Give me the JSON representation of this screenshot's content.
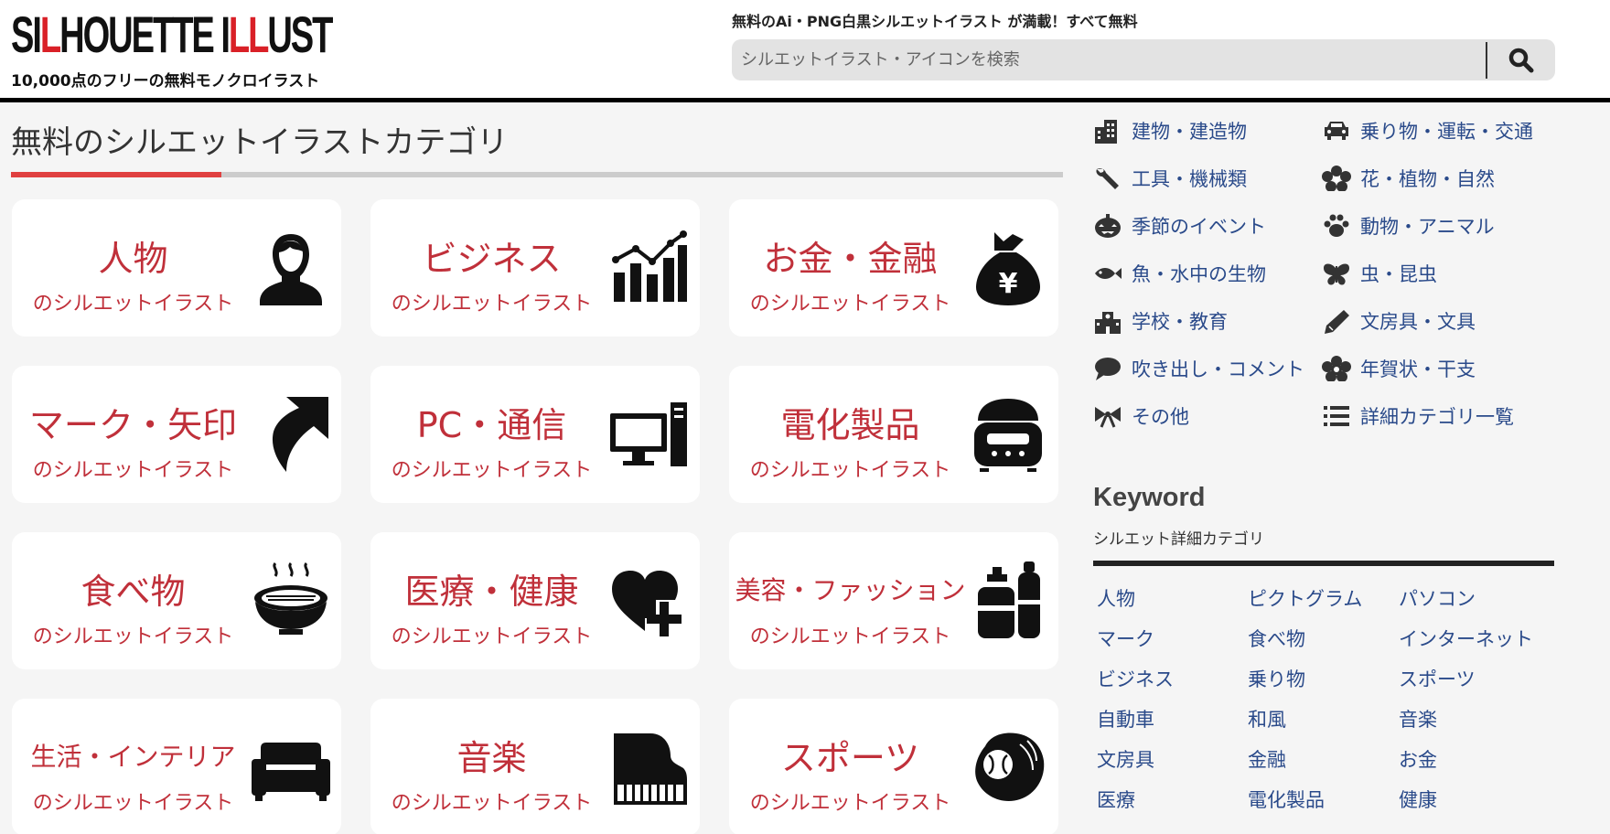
{
  "header": {
    "logo_part1": "SI",
    "logo_part2": "L",
    "logo_part3": "HOUETTE I",
    "logo_part4": "LL",
    "logo_part5": "UST",
    "logo_sub": "10,000点のフリーの無料モノクロイラスト",
    "tagline": "無料のAi・PNG白黒シルエットイラスト が満載！すべて無料",
    "search_placeholder": "シルエットイラスト・アイコンを検索",
    "brand_red": "#d92027"
  },
  "main": {
    "title": "無料のシルエットイラストカテゴリ",
    "card_subtitle": "のシルエットイラスト",
    "cards": [
      {
        "title": "人物",
        "icon": "person-icon"
      },
      {
        "title": "ビジネス",
        "icon": "bar-chart-icon"
      },
      {
        "title": "お金・金融",
        "icon": "money-bag-icon"
      },
      {
        "title": "マーク・矢印",
        "icon": "arrow-icon"
      },
      {
        "title": "PC・通信",
        "icon": "computer-icon"
      },
      {
        "title": "電化製品",
        "icon": "rice-cooker-icon"
      },
      {
        "title": "食べ物",
        "icon": "ramen-bowl-icon"
      },
      {
        "title": "医療・健康",
        "icon": "heart-plus-icon"
      },
      {
        "title": "美容・ファッション",
        "icon": "cosmetics-icon"
      },
      {
        "title": "生活・インテリア",
        "icon": "sofa-icon"
      },
      {
        "title": "音楽",
        "icon": "piano-icon"
      },
      {
        "title": "スポーツ",
        "icon": "baseball-glove-icon"
      }
    ]
  },
  "sidebar": {
    "categories": [
      {
        "label": "建物・建造物",
        "icon": "building-icon"
      },
      {
        "label": "乗り物・運転・交通",
        "icon": "car-icon"
      },
      {
        "label": "工具・機械類",
        "icon": "wrench-icon"
      },
      {
        "label": "花・植物・自然",
        "icon": "flower-icon"
      },
      {
        "label": "季節のイベント",
        "icon": "pumpkin-icon"
      },
      {
        "label": "動物・アニマル",
        "icon": "paw-icon"
      },
      {
        "label": "魚・水中の生物",
        "icon": "fish-icon"
      },
      {
        "label": "虫・昆虫",
        "icon": "butterfly-icon"
      },
      {
        "label": "学校・教育",
        "icon": "school-icon"
      },
      {
        "label": "文房具・文具",
        "icon": "pen-icon"
      },
      {
        "label": "吹き出し・コメント",
        "icon": "speech-bubble-icon"
      },
      {
        "label": "年賀状・干支",
        "icon": "plum-flower-icon"
      },
      {
        "label": "その他",
        "icon": "ribbon-icon"
      },
      {
        "label": "詳細カテゴリ一覧",
        "icon": "list-icon"
      }
    ],
    "keyword_title": "Keyword",
    "keyword_sub": "シルエット詳細カテゴリ",
    "keywords": [
      "人物",
      "ピクトグラム",
      "パソコン",
      "マーク",
      "食べ物",
      "インターネット",
      "ビジネス",
      "乗り物",
      "スポーツ",
      "自動車",
      "和風",
      "音楽",
      "文房具",
      "金融",
      "お金",
      "医療",
      "電化製品",
      "健康"
    ],
    "link_color": "#2a4a8a"
  }
}
